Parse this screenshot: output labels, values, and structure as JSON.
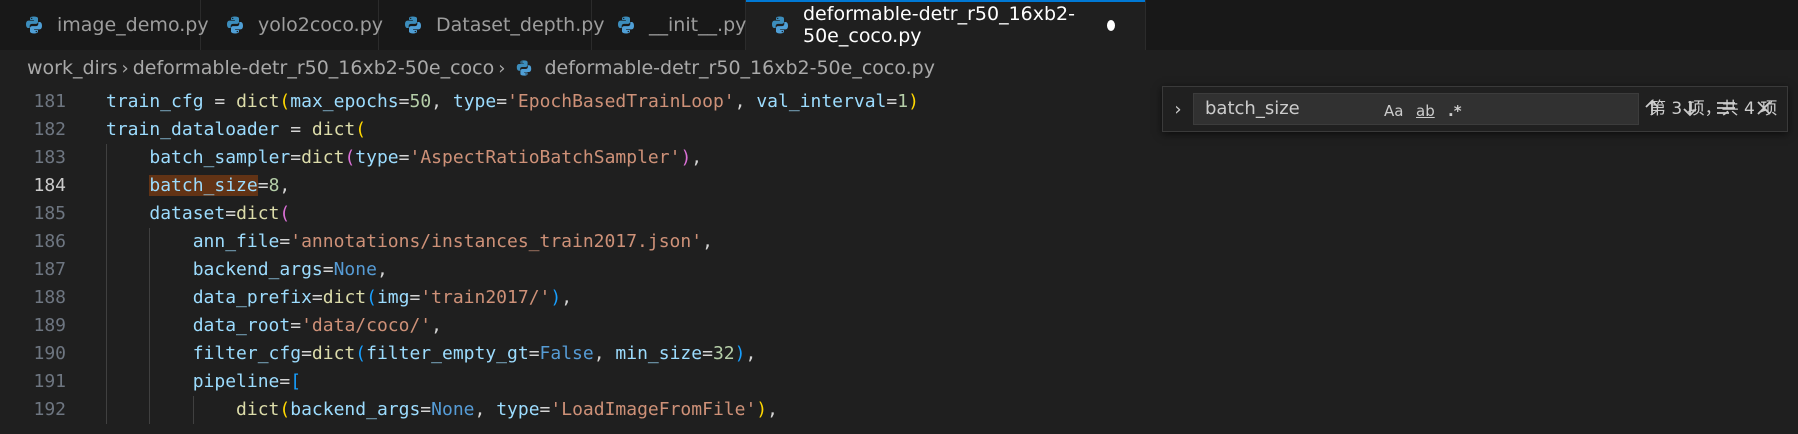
{
  "tabs": [
    {
      "label": "image_demo.py",
      "active": false
    },
    {
      "label": "yolo2coco.py",
      "active": false
    },
    {
      "label": "Dataset_depth.py",
      "active": false
    },
    {
      "label": "__init__.py",
      "active": false
    },
    {
      "label": "deformable-detr_r50_16xb2-50e_coco.py",
      "active": true,
      "dirty": true
    }
  ],
  "breadcrumb": {
    "folder1": "work_dirs",
    "folder2": "deformable-detr_r50_16xb2-50e_coco",
    "file": "deformable-detr_r50_16xb2-50e_coco.py"
  },
  "find": {
    "query": "batch_size",
    "match_case": "Aa",
    "whole_word": "ab",
    "regex": ".*",
    "count": "第 3 项，共 4 项"
  },
  "editor": {
    "current_line": 184,
    "lines": [
      {
        "n": "181",
        "tokens": [
          [
            "var",
            "train_cfg"
          ],
          [
            "op",
            " = "
          ],
          [
            "fn",
            "dict"
          ],
          [
            "b1",
            "("
          ],
          [
            "var",
            "max_epochs"
          ],
          [
            "op",
            "="
          ],
          [
            "num",
            "50"
          ],
          [
            "op",
            ", "
          ],
          [
            "var",
            "type"
          ],
          [
            "op",
            "="
          ],
          [
            "str",
            "'EpochBasedTrainLoop'"
          ],
          [
            "op",
            ", "
          ],
          [
            "var",
            "val_interval"
          ],
          [
            "op",
            "="
          ],
          [
            "num",
            "1"
          ],
          [
            "b1",
            ")"
          ]
        ]
      },
      {
        "n": "182",
        "tokens": [
          [
            "var",
            "train_dataloader"
          ],
          [
            "op",
            " = "
          ],
          [
            "fn",
            "dict"
          ],
          [
            "b1",
            "("
          ]
        ]
      },
      {
        "n": "183",
        "tokens": [
          [
            "op",
            "    "
          ],
          [
            "var",
            "batch_sampler"
          ],
          [
            "op",
            "="
          ],
          [
            "fn",
            "dict"
          ],
          [
            "b2",
            "("
          ],
          [
            "var",
            "type"
          ],
          [
            "op",
            "="
          ],
          [
            "str",
            "'AspectRatioBatchSampler'"
          ],
          [
            "b2",
            ")"
          ],
          [
            "op",
            ","
          ]
        ]
      },
      {
        "n": "184",
        "tokens": [
          [
            "op",
            "    "
          ],
          [
            "match",
            "batch_size"
          ],
          [
            "op",
            "="
          ],
          [
            "num",
            "8"
          ],
          [
            "op",
            ","
          ]
        ]
      },
      {
        "n": "185",
        "tokens": [
          [
            "op",
            "    "
          ],
          [
            "var",
            "dataset"
          ],
          [
            "op",
            "="
          ],
          [
            "fn",
            "dict"
          ],
          [
            "b2",
            "("
          ]
        ]
      },
      {
        "n": "186",
        "tokens": [
          [
            "op",
            "        "
          ],
          [
            "var",
            "ann_file"
          ],
          [
            "op",
            "="
          ],
          [
            "str",
            "'annotations/instances_train2017.json'"
          ],
          [
            "op",
            ","
          ]
        ]
      },
      {
        "n": "187",
        "tokens": [
          [
            "op",
            "        "
          ],
          [
            "var",
            "backend_args"
          ],
          [
            "op",
            "="
          ],
          [
            "const",
            "None"
          ],
          [
            "op",
            ","
          ]
        ]
      },
      {
        "n": "188",
        "tokens": [
          [
            "op",
            "        "
          ],
          [
            "var",
            "data_prefix"
          ],
          [
            "op",
            "="
          ],
          [
            "fn",
            "dict"
          ],
          [
            "b3",
            "("
          ],
          [
            "var",
            "img"
          ],
          [
            "op",
            "="
          ],
          [
            "str",
            "'train2017/'"
          ],
          [
            "b3",
            ")"
          ],
          [
            "op",
            ","
          ]
        ]
      },
      {
        "n": "189",
        "tokens": [
          [
            "op",
            "        "
          ],
          [
            "var",
            "data_root"
          ],
          [
            "op",
            "="
          ],
          [
            "str",
            "'data/coco/'"
          ],
          [
            "op",
            ","
          ]
        ]
      },
      {
        "n": "190",
        "tokens": [
          [
            "op",
            "        "
          ],
          [
            "var",
            "filter_cfg"
          ],
          [
            "op",
            "="
          ],
          [
            "fn",
            "dict"
          ],
          [
            "b3",
            "("
          ],
          [
            "var",
            "filter_empty_gt"
          ],
          [
            "op",
            "="
          ],
          [
            "const",
            "False"
          ],
          [
            "op",
            ", "
          ],
          [
            "var",
            "min_size"
          ],
          [
            "op",
            "="
          ],
          [
            "num",
            "32"
          ],
          [
            "b3",
            ")"
          ],
          [
            "op",
            ","
          ]
        ]
      },
      {
        "n": "191",
        "tokens": [
          [
            "op",
            "        "
          ],
          [
            "var",
            "pipeline"
          ],
          [
            "op",
            "="
          ],
          [
            "b3",
            "["
          ]
        ]
      },
      {
        "n": "192",
        "tokens": [
          [
            "op",
            "            "
          ],
          [
            "fn",
            "dict"
          ],
          [
            "b1",
            "("
          ],
          [
            "var",
            "backend_args"
          ],
          [
            "op",
            "="
          ],
          [
            "const",
            "None"
          ],
          [
            "op",
            ", "
          ],
          [
            "var",
            "type"
          ],
          [
            "op",
            "="
          ],
          [
            "str",
            "'LoadImageFromFile'"
          ],
          [
            "b1",
            ")"
          ],
          [
            "op",
            ","
          ]
        ]
      }
    ]
  }
}
